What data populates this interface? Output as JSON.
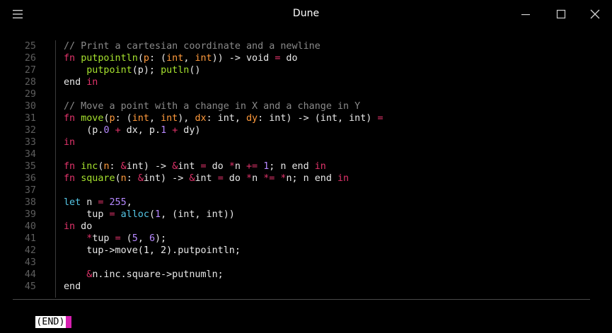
{
  "window": {
    "title": "Dune"
  },
  "icons": {
    "menu": "hamburger-menu-icon",
    "minimize": "minimize-icon",
    "maximize": "maximize-icon",
    "close": "close-icon"
  },
  "colors": {
    "background": "#000000",
    "comment": "#8a8a8a",
    "keyword": "#e0336a",
    "function": "#a6e22e",
    "type_param": "#ff9a3c",
    "number": "#b688ff",
    "let": "#56c8e8",
    "line_number": "#5e5e5e",
    "cursor": "#d61fb0"
  },
  "lines": [
    {
      "n": "25",
      "segs": [
        [
          "comment",
          "// Print a cartesian coordinate and a newline"
        ]
      ]
    },
    {
      "n": "26",
      "segs": [
        [
          "kw",
          "fn "
        ],
        [
          "fn",
          "putpointln"
        ],
        [
          "plain",
          "("
        ],
        [
          "type",
          "p"
        ],
        [
          "plain",
          ": ("
        ],
        [
          "type",
          "int"
        ],
        [
          "plain",
          ", "
        ],
        [
          "type",
          "int"
        ],
        [
          "plain",
          ")) -> void "
        ],
        [
          "kw",
          "="
        ],
        [
          "plain",
          " do"
        ]
      ]
    },
    {
      "n": "27",
      "segs": [
        [
          "plain",
          "    "
        ],
        [
          "fn",
          "putpoint"
        ],
        [
          "plain",
          "(p); "
        ],
        [
          "fn",
          "putln"
        ],
        [
          "plain",
          "()"
        ]
      ]
    },
    {
      "n": "28",
      "segs": [
        [
          "plain",
          "end "
        ],
        [
          "kw",
          "in"
        ]
      ]
    },
    {
      "n": "29",
      "segs": []
    },
    {
      "n": "30",
      "segs": [
        [
          "comment",
          "// Move a point with a change in X and a change in Y"
        ]
      ]
    },
    {
      "n": "31",
      "segs": [
        [
          "kw",
          "fn "
        ],
        [
          "fn",
          "move"
        ],
        [
          "plain",
          "("
        ],
        [
          "type",
          "p"
        ],
        [
          "plain",
          ": ("
        ],
        [
          "type",
          "int"
        ],
        [
          "plain",
          ", "
        ],
        [
          "type",
          "int"
        ],
        [
          "plain",
          "), "
        ],
        [
          "type",
          "dx"
        ],
        [
          "plain",
          ": int, "
        ],
        [
          "type",
          "dy"
        ],
        [
          "plain",
          ": int) -> (int, int) "
        ],
        [
          "kw",
          "="
        ]
      ]
    },
    {
      "n": "32",
      "segs": [
        [
          "plain",
          "    (p."
        ],
        [
          "num",
          "0"
        ],
        [
          "plain",
          " "
        ],
        [
          "kw",
          "+"
        ],
        [
          "plain",
          " dx, p."
        ],
        [
          "num",
          "1"
        ],
        [
          "plain",
          " "
        ],
        [
          "kw",
          "+"
        ],
        [
          "plain",
          " dy)"
        ]
      ]
    },
    {
      "n": "33",
      "segs": [
        [
          "kw",
          "in"
        ]
      ]
    },
    {
      "n": "34",
      "segs": []
    },
    {
      "n": "35",
      "segs": [
        [
          "kw",
          "fn "
        ],
        [
          "fn",
          "inc"
        ],
        [
          "plain",
          "("
        ],
        [
          "type",
          "n"
        ],
        [
          "plain",
          ": "
        ],
        [
          "kw",
          "&"
        ],
        [
          "plain",
          "int) -> "
        ],
        [
          "kw",
          "&"
        ],
        [
          "plain",
          "int "
        ],
        [
          "kw",
          "="
        ],
        [
          "plain",
          " do "
        ],
        [
          "kw",
          "*"
        ],
        [
          "plain",
          "n "
        ],
        [
          "kw",
          "+="
        ],
        [
          "plain",
          " "
        ],
        [
          "num",
          "1"
        ],
        [
          "plain",
          "; n end "
        ],
        [
          "kw",
          "in"
        ]
      ]
    },
    {
      "n": "36",
      "segs": [
        [
          "kw",
          "fn "
        ],
        [
          "fn",
          "square"
        ],
        [
          "plain",
          "("
        ],
        [
          "type",
          "n"
        ],
        [
          "plain",
          ": "
        ],
        [
          "kw",
          "&"
        ],
        [
          "plain",
          "int) -> "
        ],
        [
          "kw",
          "&"
        ],
        [
          "plain",
          "int "
        ],
        [
          "kw",
          "="
        ],
        [
          "plain",
          " do "
        ],
        [
          "kw",
          "*"
        ],
        [
          "plain",
          "n "
        ],
        [
          "kw",
          "*="
        ],
        [
          "plain",
          " "
        ],
        [
          "kw",
          "*"
        ],
        [
          "plain",
          "n; n end "
        ],
        [
          "kw",
          "in"
        ]
      ]
    },
    {
      "n": "37",
      "segs": []
    },
    {
      "n": "38",
      "segs": [
        [
          "let",
          "let"
        ],
        [
          "plain",
          " n "
        ],
        [
          "kw",
          "="
        ],
        [
          "plain",
          " "
        ],
        [
          "num",
          "255"
        ],
        [
          "plain",
          ","
        ]
      ]
    },
    {
      "n": "39",
      "segs": [
        [
          "plain",
          "    tup "
        ],
        [
          "kw",
          "="
        ],
        [
          "plain",
          " "
        ],
        [
          "let",
          "alloc"
        ],
        [
          "plain",
          "("
        ],
        [
          "num",
          "1"
        ],
        [
          "plain",
          ", (int, int))"
        ]
      ]
    },
    {
      "n": "40",
      "segs": [
        [
          "kw",
          "in"
        ],
        [
          "plain",
          " do"
        ]
      ]
    },
    {
      "n": "41",
      "segs": [
        [
          "plain",
          "    "
        ],
        [
          "kw",
          "*"
        ],
        [
          "plain",
          "tup "
        ],
        [
          "kw",
          "="
        ],
        [
          "plain",
          " ("
        ],
        [
          "num",
          "5"
        ],
        [
          "plain",
          ", "
        ],
        [
          "num",
          "6"
        ],
        [
          "plain",
          ");"
        ]
      ]
    },
    {
      "n": "42",
      "segs": [
        [
          "plain",
          "    tup->move(1, 2).putpointln;"
        ]
      ]
    },
    {
      "n": "43",
      "segs": []
    },
    {
      "n": "44",
      "segs": [
        [
          "plain",
          "    "
        ],
        [
          "kw",
          "&"
        ],
        [
          "plain",
          "n.inc.square->putnumln;"
        ]
      ]
    },
    {
      "n": "45",
      "segs": [
        [
          "plain",
          "end"
        ]
      ]
    }
  ],
  "status": {
    "label": "(END)"
  }
}
